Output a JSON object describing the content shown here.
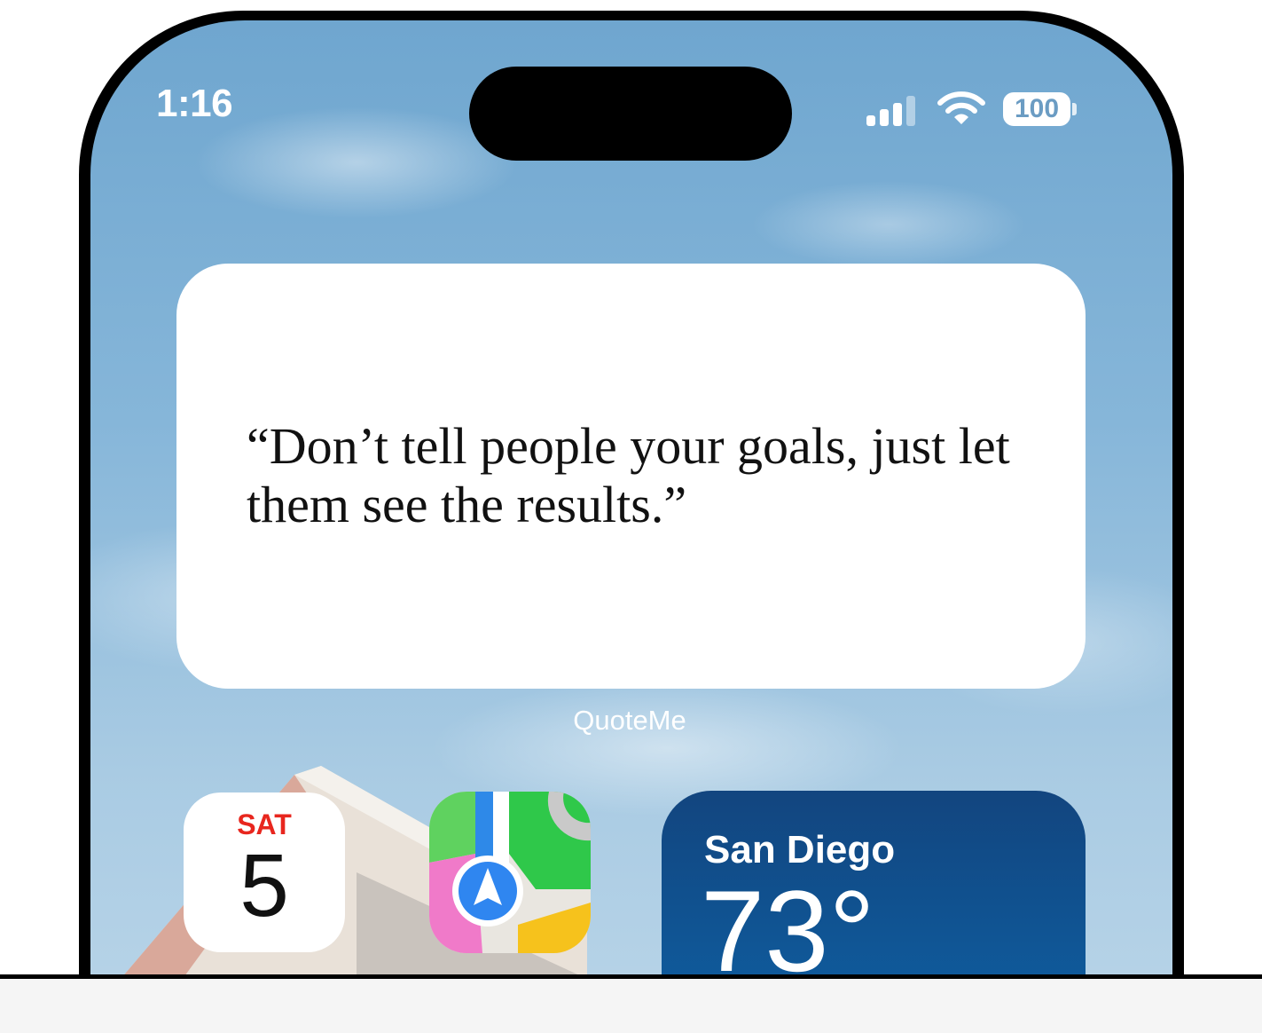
{
  "status_bar": {
    "time": "1:16",
    "battery": "100",
    "icons": [
      "cellular-signal-icon",
      "wifi-icon",
      "battery-icon"
    ]
  },
  "quote_widget": {
    "quote": "“Don’t tell people your goals, just let them see the results.”",
    "caption": "QuoteMe"
  },
  "calendar_icon": {
    "day": "SAT",
    "date": "5"
  },
  "maps_icon": {
    "icon": "maps-app-icon"
  },
  "weather_widget": {
    "city": "San Diego",
    "temperature": "73°"
  },
  "colors": {
    "sky": "#86b6d9",
    "calendar_red": "#e8261e",
    "weather_blue": "#12457f"
  }
}
